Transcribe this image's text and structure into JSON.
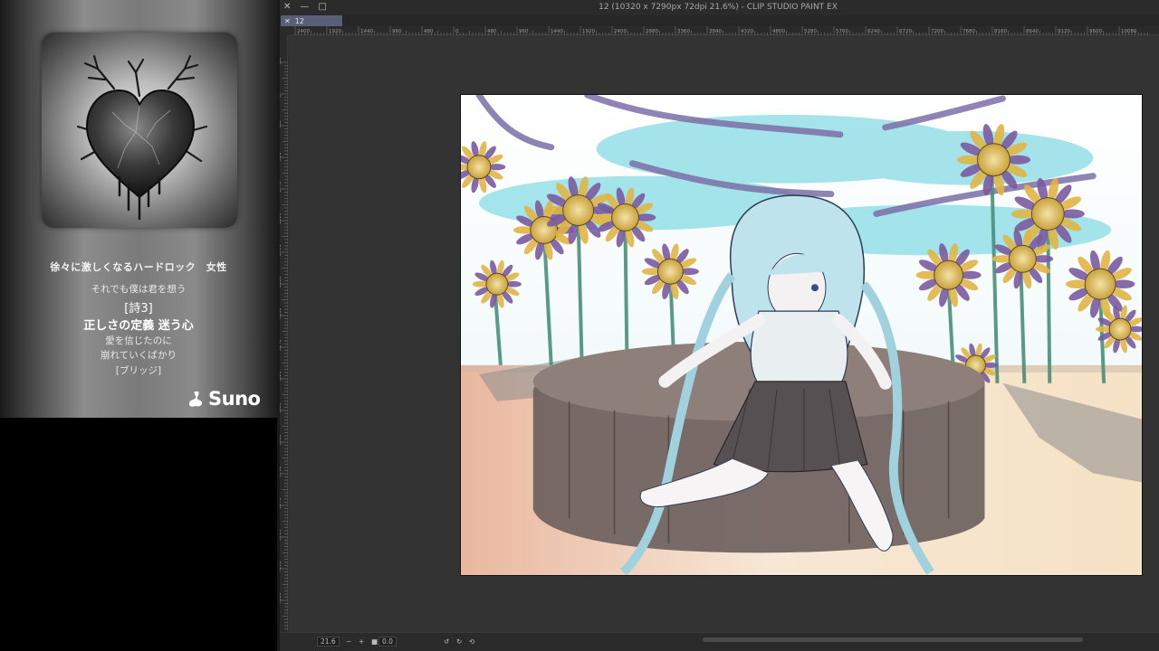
{
  "suno_panel": {
    "song_title": "徐々に激しくなるハードロック　女性",
    "lyrics": {
      "line1": "それでも僕は君を想う",
      "line2": "[詩3]",
      "line3": "正しさの定義 迷う心",
      "line4": "愛を信じたのに",
      "line5": "崩れていくばかり",
      "line6": "[ブリッジ]"
    },
    "brand": "Suno"
  },
  "app": {
    "window_title": "12 (10320 x 7290px 72dpi 21.6%)  - CLIP STUDIO PAINT EX",
    "controls": {
      "close": "✕",
      "minimize": "—",
      "maximize": "□"
    },
    "document_tab": {
      "close": "✕",
      "label": "12"
    },
    "ruler_top_labels": [
      "2400",
      "1920",
      "1440",
      "960",
      "480",
      "0",
      "480",
      "960",
      "1440",
      "1920",
      "2400",
      "2880",
      "3360",
      "3840",
      "4320",
      "4800",
      "5280",
      "5760",
      "6240",
      "6720",
      "7200",
      "7680",
      "8160",
      "8640",
      "9120",
      "9600",
      "10080"
    ],
    "ruler_left_labels": [
      "480",
      "0",
      "480",
      "960",
      "1440",
      "1920",
      "2400",
      "2880",
      "3360",
      "3840",
      "4320",
      "4800",
      "5280",
      "5760",
      "6240",
      "6720",
      "7200",
      "7680"
    ],
    "status": {
      "zoom_value": "21.6",
      "minus": "−",
      "plus": "+",
      "rotation_value": "0.0"
    }
  }
}
